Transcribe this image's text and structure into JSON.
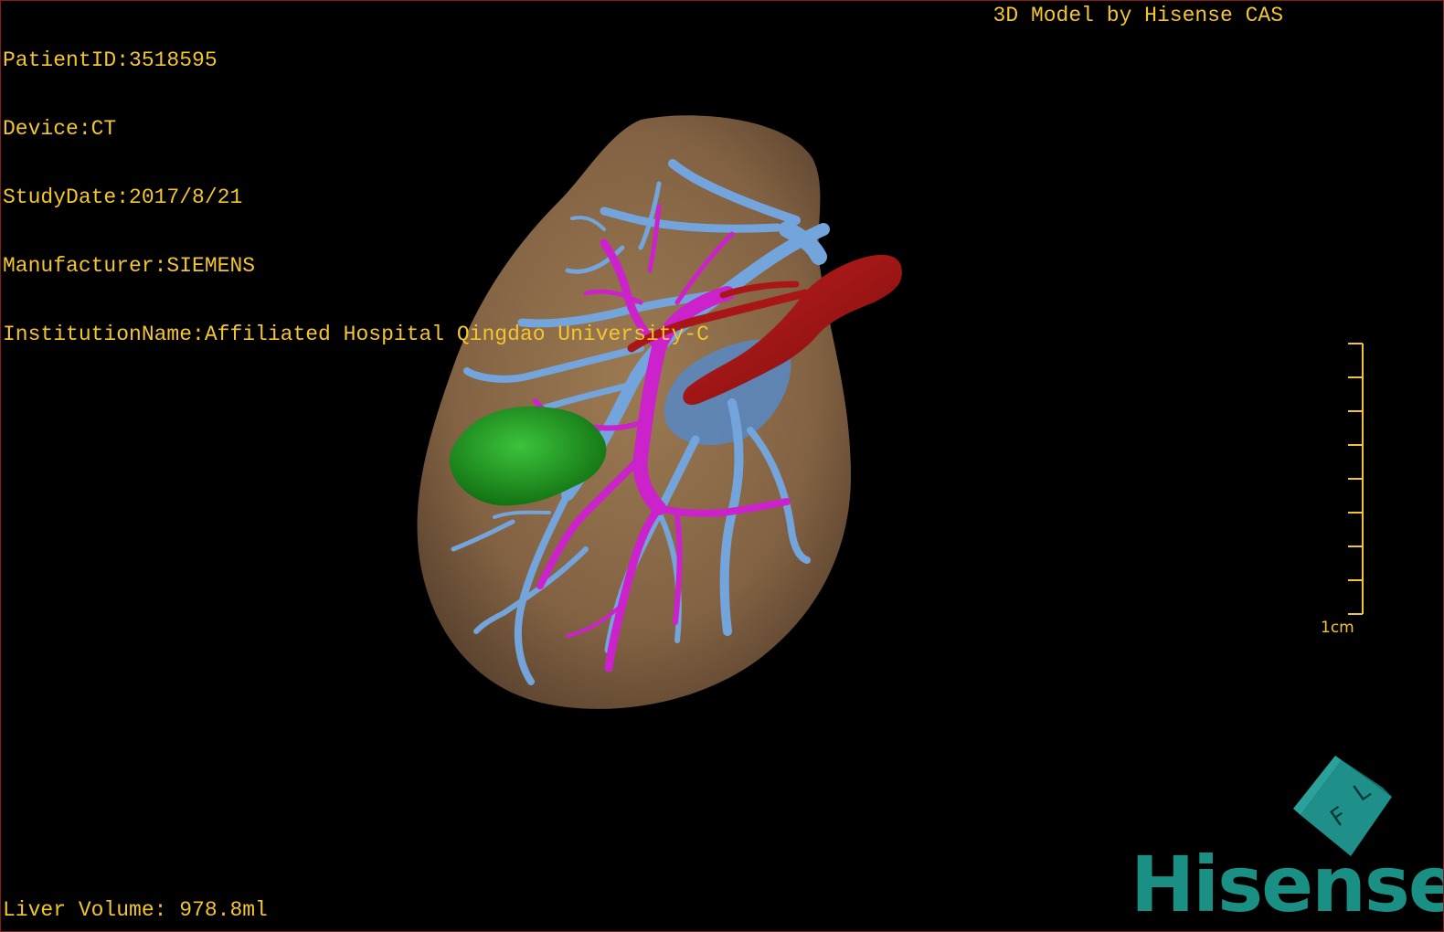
{
  "patient_info": {
    "patient_id": "PatientID:3518595",
    "device": "Device:CT",
    "study_date": "StudyDate:2017/8/21",
    "manufacturer": "Manufacturer:SIEMENS",
    "institution": "InstitutionName:Affiliated Hospital Qingdao University-C"
  },
  "watermark": "3D Model by Hisense CAS",
  "liver_volume": "Liver Volume: 978.8ml",
  "scale_bar": {
    "label": "1cm",
    "ticks": 9
  },
  "orientation_cube": {
    "face_letters": [
      "F",
      "L"
    ]
  },
  "brand_logo": "Hisense",
  "colors": {
    "overlay_text": "#f2c531",
    "liver": "#8a6a45",
    "hepatic_vein": "#6fa0d8",
    "portal_vein": "#c81ec8",
    "ivc_artery": "#9c1212",
    "tumor": "#1f9a1f",
    "brand": "#1a8f84"
  }
}
